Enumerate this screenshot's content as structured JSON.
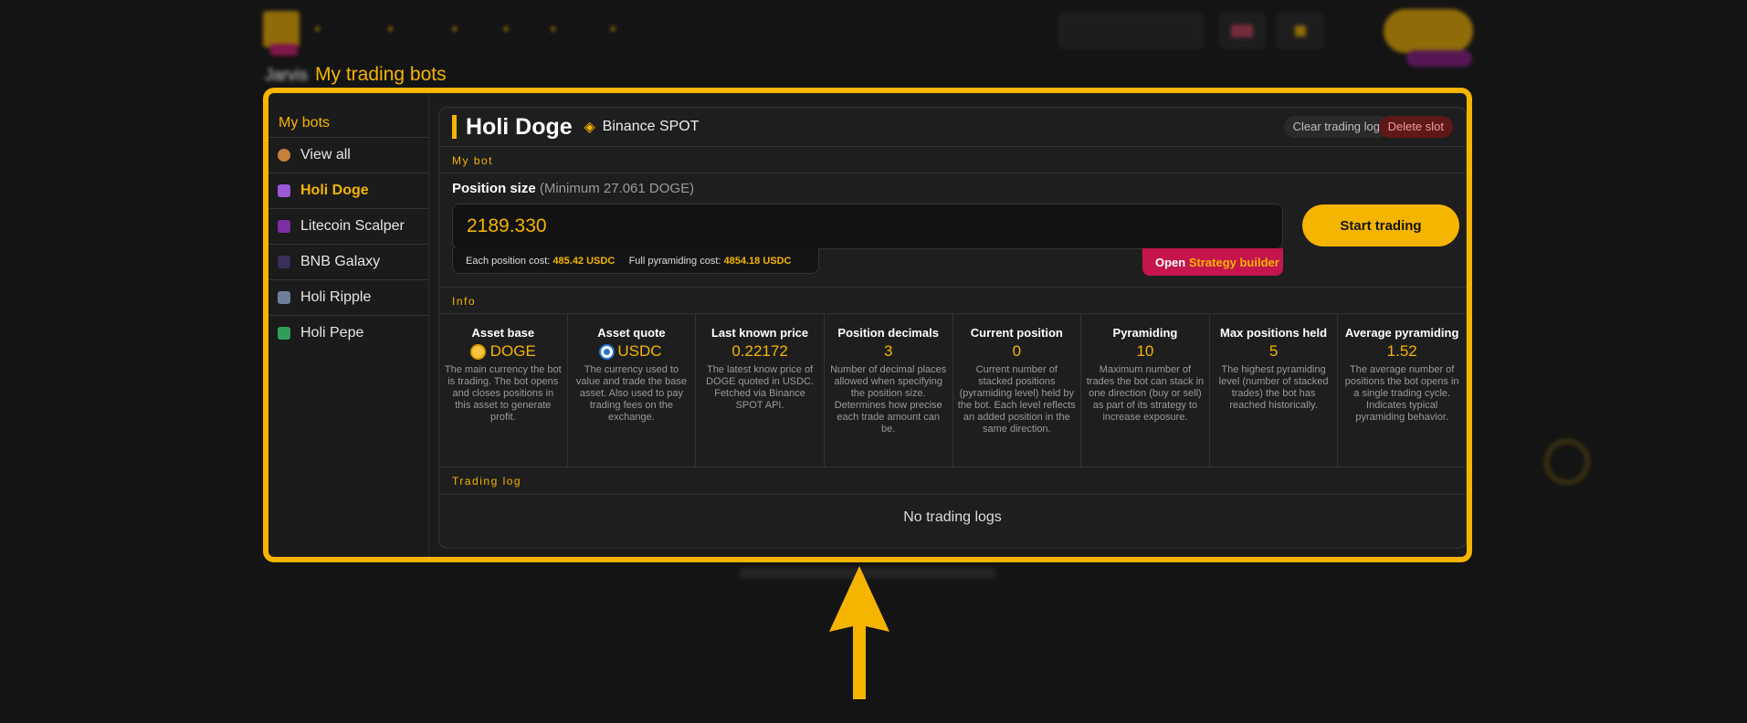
{
  "colors": {
    "accent": "#f5b400",
    "danger": "#c4154d",
    "bg": "#141414"
  },
  "page": {
    "title": "My trading bots",
    "breadcrumb": "Jarvis"
  },
  "sidebar": {
    "heading": "My bots",
    "items": [
      {
        "label": "View all",
        "icon": "user-icon"
      },
      {
        "label": "Holi Doge",
        "icon": "bot-avatar-icon"
      },
      {
        "label": "Litecoin Scalper",
        "icon": "bot-avatar-icon"
      },
      {
        "label": "BNB Galaxy",
        "icon": "bot-avatar-icon"
      },
      {
        "label": "Holi Ripple",
        "icon": "bot-avatar-icon"
      },
      {
        "label": "Holi Pepe",
        "icon": "bot-avatar-icon"
      }
    ]
  },
  "bot": {
    "name": "Holi Doge",
    "exchange": "Binance SPOT",
    "clear_log_label": "Clear trading log",
    "delete_slot_label": "Delete slot"
  },
  "sections": {
    "my_bot": "My bot",
    "info": "Info",
    "trading_log": "Trading log"
  },
  "position": {
    "label": "Position size",
    "minimum": "(Minimum 27.061 DOGE)",
    "value": "2189.330",
    "each_cost_label": "Each position cost:",
    "each_cost_value": "485.42 USDC",
    "full_cost_label": "Full pyramiding cost:",
    "full_cost_value": "4854.18 USDC",
    "strategy_prefix": "Open",
    "strategy_label": "Strategy builder",
    "start_label": "Start trading"
  },
  "info": [
    {
      "title": "Asset base",
      "value": "DOGE",
      "desc": "The main currency the bot is trading. The bot opens and closes positions in this asset to generate profit."
    },
    {
      "title": "Asset quote",
      "value": "USDC",
      "desc": "The currency used to value and trade the base asset. Also used to pay trading fees on the exchange."
    },
    {
      "title": "Last known price",
      "value": "0.22172",
      "desc": "The latest know price of DOGE quoted in USDC. Fetched via Binance SPOT API."
    },
    {
      "title": "Position decimals",
      "value": "3",
      "desc": "Number of decimal places allowed when specifying the position size. Determines how precise each trade amount can be."
    },
    {
      "title": "Current position",
      "value": "0",
      "desc": "Current number of stacked positions (pyramiding level) held by the bot. Each level reflects an added position in the same direction."
    },
    {
      "title": "Pyramiding",
      "value": "10",
      "desc": "Maximum number of trades the bot can stack in one direction (buy or sell) as part of its strategy to increase exposure."
    },
    {
      "title": "Max positions held",
      "value": "5",
      "desc": "The highest pyramiding level (number of stacked trades) the bot has reached historically."
    },
    {
      "title": "Average pyramiding",
      "value": "1.52",
      "desc": "The average number of positions the bot opens in a single trading cycle. Indicates typical pyramiding behavior."
    }
  ],
  "trading_log": {
    "empty": "No trading logs"
  }
}
